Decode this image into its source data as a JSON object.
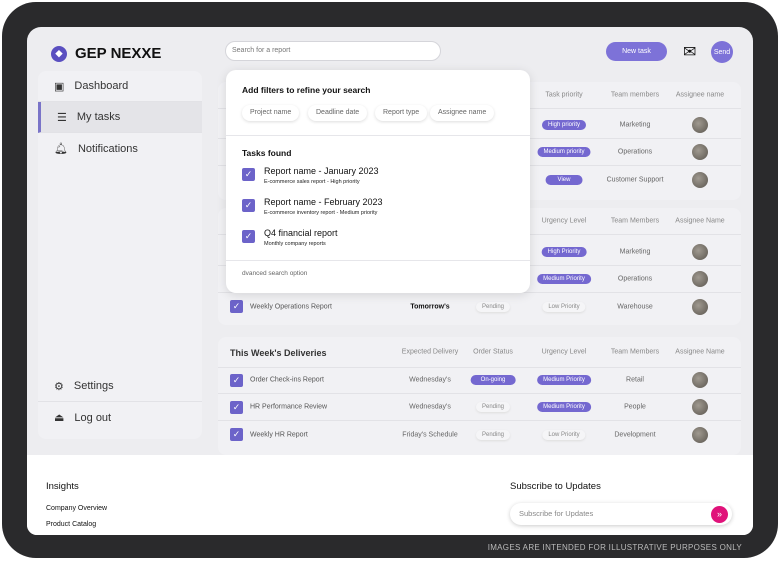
{
  "app": {
    "logo_text": "GEP NEXXE"
  },
  "sidebar": {
    "items": [
      {
        "label": "Dashboard"
      },
      {
        "label": "My tasks"
      },
      {
        "label": "Notifications"
      }
    ],
    "settings": "Settings",
    "logout": "Log out"
  },
  "header": {
    "search_placeholder": "Search for a report",
    "new_task": "New task",
    "send": "Send"
  },
  "popup": {
    "title": "Add filters to refine your search",
    "filters": [
      "Project name",
      "Deadline date",
      "Report type",
      "Assignee name"
    ],
    "tasks_title": "Tasks found",
    "tasks": [
      {
        "title": "Report name - January 2023",
        "sub": "E-commerce sales report - High priority"
      },
      {
        "title": "Report name - February 2023",
        "sub": "E-commerce inventory report - Medium priority"
      },
      {
        "title": "Q4 financial report",
        "sub": "Monthly company reports"
      }
    ],
    "advanced": "dvanced search option"
  },
  "table1": {
    "headers": [
      "Task priority",
      "Team members",
      "Assignee name"
    ],
    "rows": [
      {
        "priority": "High priority",
        "team": "Marketing"
      },
      {
        "priority": "Medium priority",
        "team": "Operations"
      },
      {
        "priority": "View",
        "team": "Customer Support"
      }
    ]
  },
  "table2": {
    "headers": [
      "Urgency Level",
      "Team Members",
      "Assignee Name"
    ],
    "rows": [
      {
        "urgency": "High Priority",
        "team": "Marketing"
      },
      {
        "urgency": "Medium Priority",
        "team": "Operations"
      },
      {
        "name": "Weekly Operations Report",
        "date": "Tomorrow's",
        "status": "Pending",
        "urgency": "Low Priority",
        "team": "Warehouse"
      }
    ]
  },
  "table3": {
    "title": "This Week's Deliveries",
    "headers": [
      "Expected Delivery",
      "Order Status",
      "Urgency Level",
      "Team Members",
      "Assignee Name"
    ],
    "rows": [
      {
        "name": "Order Check-ins Report",
        "date": "Wednesday's",
        "status": "On-going",
        "urgency": "Medium Priority",
        "team": "Retail"
      },
      {
        "name": "HR Performance Review",
        "date": "Wednesday's",
        "status": "Pending",
        "urgency": "Medium Priority",
        "team": "People"
      },
      {
        "name": "Weekly HR Report",
        "date": "Friday's Schedule",
        "status": "Pending",
        "urgency": "Low Priority",
        "team": "Development"
      }
    ]
  },
  "footer": {
    "insights": "Insights",
    "links": [
      "Company Overview",
      "Product Catalog"
    ],
    "subscribe_title": "Subscribe to Updates",
    "subscribe_placeholder": "Subscribe for Updates"
  },
  "caption": "IMAGES ARE INTENDED FOR ILLUSTRATIVE PURPOSES ONLY"
}
